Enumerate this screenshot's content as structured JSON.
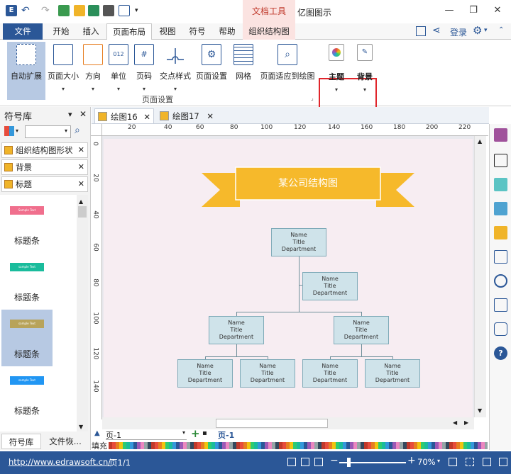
{
  "titlebar": {
    "context_tab": "文档工具",
    "app_title": "亿图图示",
    "window_buttons": [
      "—",
      "❐",
      "✕"
    ]
  },
  "tabs": [
    {
      "label": "文件"
    },
    {
      "label": "开始"
    },
    {
      "label": "插入"
    },
    {
      "label": "页面布局"
    },
    {
      "label": "视图"
    },
    {
      "label": "符号"
    },
    {
      "label": "帮助"
    },
    {
      "label": "组织结构图"
    }
  ],
  "login": "登录",
  "ribbon": {
    "buttons": [
      "自动扩展",
      "页面大小",
      "方向",
      "单位",
      "页码",
      "交点样式",
      "页面设置",
      "网格",
      "页面适应到绘图"
    ],
    "group_label": "页面设置",
    "theme": "主题",
    "background": "背景"
  },
  "library": {
    "title": "符号库",
    "categories": [
      "组织结构图形状",
      "背景",
      "标题"
    ],
    "shapes": [
      "标题条",
      "标题条",
      "标题条",
      "标题条"
    ],
    "shape_texts": [
      "Sample Text",
      "sample Text",
      "sample Text",
      "sample Text"
    ],
    "bottom_tabs": [
      "符号库",
      "文件恢..."
    ]
  },
  "doc_tabs": [
    "绘图16",
    "绘图17"
  ],
  "ruler": {
    "h": [
      "20",
      "40",
      "60",
      "80",
      "100",
      "120",
      "140",
      "160",
      "180",
      "200",
      "220"
    ],
    "v": [
      "0",
      "20",
      "40",
      "60",
      "80",
      "100",
      "120",
      "140"
    ]
  },
  "diagram": {
    "title": "某公司结构图",
    "box_lines": [
      "Name",
      "Title",
      "Department"
    ]
  },
  "pagebar": {
    "page_select": "页-1",
    "page_tab": "页-1"
  },
  "palette_label": "填充",
  "status": {
    "url": "http://www.edrawsoft.cn/",
    "page": "页1/1",
    "zoom": "70%"
  },
  "colors": {
    "brand": "#2b5797",
    "title_ribbon": "#f6b92b",
    "highlight": "#e0252b"
  }
}
